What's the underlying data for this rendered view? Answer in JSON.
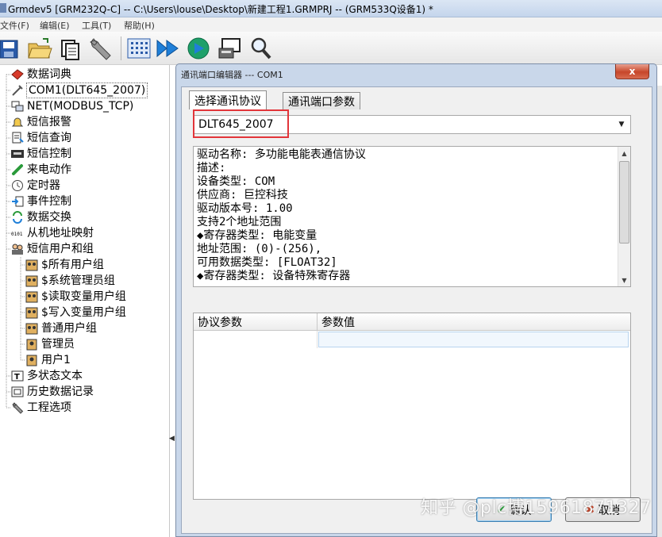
{
  "window": {
    "title": "Grmdev5 [GRM232Q-C]  -- C:\\Users\\louse\\Desktop\\新建工程1.GRMPRJ -- (GRM533Q设备1) *"
  },
  "menu": [
    "文件(F)",
    "编辑(E)",
    "工具(T)",
    "帮助(H)"
  ],
  "toolbar": {
    "buttons": [
      "save-icon",
      "open-folder-icon",
      "copy-icon",
      "wrench-icon",
      "grid-dots-icon",
      "forward-arrow-icon",
      "run-icon",
      "monitor-icon",
      "search-icon"
    ]
  },
  "tree": {
    "items": [
      {
        "label": "数据词典",
        "icon": "book-icon"
      },
      {
        "label": "COM1(DLT645_2007)",
        "icon": "com-port-icon",
        "selected": true
      },
      {
        "label": "NET(MODBUS_TCP)",
        "icon": "network-icon"
      },
      {
        "label": "短信报警",
        "icon": "bell-icon"
      },
      {
        "label": "短信查询",
        "icon": "query-icon"
      },
      {
        "label": "短信控制",
        "icon": "cmd-icon"
      },
      {
        "label": "来电动作",
        "icon": "phone-icon"
      },
      {
        "label": "定时器",
        "icon": "clock-icon"
      },
      {
        "label": "事件控制",
        "icon": "event-icon"
      },
      {
        "label": "数据交换",
        "icon": "exchange-icon"
      },
      {
        "label": "从机地址映射",
        "icon": "binary-icon"
      },
      {
        "label": "短信用户和组",
        "icon": "users-icon"
      },
      {
        "label": "$所有用户组",
        "icon": "user-group-icon"
      },
      {
        "label": "$系统管理员组",
        "icon": "user-group-icon"
      },
      {
        "label": "$读取变量用户组",
        "icon": "user-group-icon"
      },
      {
        "label": "$写入变量用户组",
        "icon": "user-group-icon"
      },
      {
        "label": "普通用户组",
        "icon": "user-group-icon"
      },
      {
        "label": "管理员",
        "icon": "user-icon"
      },
      {
        "label": "用户1",
        "icon": "user-icon"
      },
      {
        "label": "多状态文本",
        "icon": "text-icon"
      },
      {
        "label": "历史数据记录",
        "icon": "history-icon"
      },
      {
        "label": "工程选项",
        "icon": "wrench-icon"
      }
    ]
  },
  "dialog": {
    "title": "通讯端口编辑器 --- COM1",
    "close": "x",
    "tabs": [
      "选择通讯协议",
      "通讯端口参数"
    ],
    "protocol_selected": "DLT645_2007",
    "description_lines": [
      "驱动名称: 多功能电能表通信协议",
      "描述:",
      "设备类型: COM",
      "供应商: 巨控科技",
      "驱动版本号: 1.00",
      "支持2个地址范围",
      "◆寄存器类型: 电能变量",
      "地址范围: (0)-(256),",
      "可用数据类型: [FLOAT32]",
      "◆寄存器类型: 设备特殊寄存器"
    ],
    "grid": {
      "columns": [
        "协议参数",
        "参数值"
      ]
    },
    "buttons": {
      "ok": "确认",
      "cancel": "取消"
    }
  },
  "watermark": "知乎 @plc博15961871327",
  "colors": {
    "highlight_box": "#e2353a",
    "dialog_frame": "#c9d7ea",
    "close_button": "#c7462a"
  }
}
